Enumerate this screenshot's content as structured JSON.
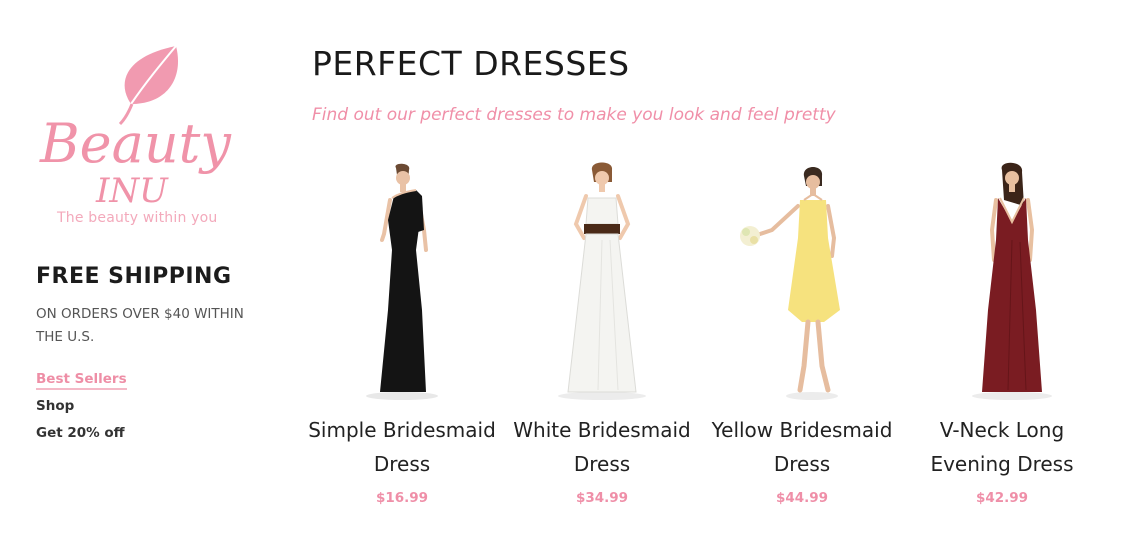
{
  "brand": {
    "logo_word1": "Beauty",
    "logo_word2": "INU",
    "tagline": "The beauty within you",
    "accent_color": "#f093a9"
  },
  "sidebar": {
    "shipping_title": "FREE SHIPPING",
    "shipping_note": "ON ORDERS OVER $40 WITHIN THE U.S.",
    "links": [
      {
        "label": "Best Sellers",
        "active": true
      },
      {
        "label": "Shop",
        "active": false
      },
      {
        "label": "Get 20% off",
        "active": false
      }
    ]
  },
  "main": {
    "title": "PERFECT DRESSES",
    "subtitle": "Find out our perfect dresses to make you look and feel pretty",
    "products": [
      {
        "name": "Simple Bridesmaid Dress",
        "price": "$16.99",
        "dress_color": "#141414"
      },
      {
        "name": "White Bridesmaid Dress",
        "price": "$34.99",
        "dress_color": "#f4f4f1"
      },
      {
        "name": "Yellow Bridesmaid Dress",
        "price": "$44.99",
        "dress_color": "#f6e27e"
      },
      {
        "name": "V-Neck Long Evening Dress",
        "price": "$42.99",
        "dress_color": "#7a1c22"
      }
    ]
  }
}
